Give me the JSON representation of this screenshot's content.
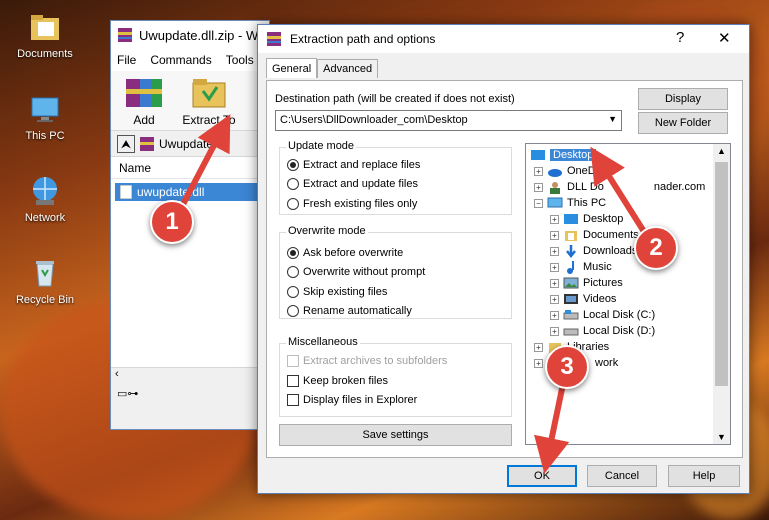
{
  "desktop": {
    "icons": [
      {
        "label": "Documents",
        "icon": "folder-documents-icon"
      },
      {
        "label": "This PC",
        "icon": "monitor-icon"
      },
      {
        "label": "Network",
        "icon": "network-globe-icon"
      },
      {
        "label": "Recycle Bin",
        "icon": "recycle-bin-icon"
      }
    ]
  },
  "winrar": {
    "title": "Uwupdate.dll.zip - W",
    "menu": [
      "File",
      "Commands",
      "Tools"
    ],
    "toolbar": [
      {
        "label": "Add",
        "icon": "rar-add-icon"
      },
      {
        "label": "Extract To",
        "icon": "extract-to-icon"
      }
    ],
    "path": "Uwupdate.d",
    "list_header": "Name",
    "file": "uwupdate.dll"
  },
  "dialog": {
    "title": "Extraction path and options",
    "help": "?",
    "close": "✕",
    "tabs": [
      "General",
      "Advanced"
    ],
    "dest_label": "Destination path (will be created if does not exist)",
    "dest_value": "C:\\Users\\DllDownloader_com\\Desktop",
    "display_btn": "Display",
    "new_folder_btn": "New Folder",
    "update_mode": {
      "title": "Update mode",
      "options": [
        "Extract and replace files",
        "Extract and update files",
        "Fresh existing files only"
      ],
      "selected": 0
    },
    "overwrite_mode": {
      "title": "Overwrite mode",
      "options": [
        "Ask before overwrite",
        "Overwrite without prompt",
        "Skip existing files",
        "Rename automatically"
      ],
      "selected": 0
    },
    "misc": {
      "title": "Miscellaneous",
      "options": [
        "Extract archives to subfolders",
        "Keep broken files",
        "Display files in Explorer"
      ]
    },
    "save_settings": "Save settings",
    "tree": [
      {
        "label": "Desktop",
        "icon": "desktop-icon",
        "selected": true
      },
      {
        "label": "OneD",
        "icon": "onedrive-cloud-icon"
      },
      {
        "label": "DLL Do",
        "label2": "nader.com",
        "icon": "user-icon"
      },
      {
        "label": "This PC",
        "icon": "monitor-icon"
      },
      {
        "label": "Desktop",
        "icon": "desktop-icon"
      },
      {
        "label": "Documents",
        "icon": "documents-icon"
      },
      {
        "label": "Downloads",
        "icon": "downloads-arrow-icon"
      },
      {
        "label": "Music",
        "icon": "music-note-icon"
      },
      {
        "label": "Pictures",
        "icon": "pictures-icon"
      },
      {
        "label": "Videos",
        "icon": "videos-icon"
      },
      {
        "label": "Local Disk (C:)",
        "icon": "disk-icon"
      },
      {
        "label": "Local Disk (D:)",
        "icon": "disk-icon"
      },
      {
        "label": "Libraries",
        "icon": "libraries-icon"
      },
      {
        "label": "work",
        "icon": "network-icon"
      }
    ],
    "ok": "OK",
    "cancel": "Cancel",
    "help_btn": "Help"
  },
  "annotations": [
    "1",
    "2",
    "3"
  ]
}
